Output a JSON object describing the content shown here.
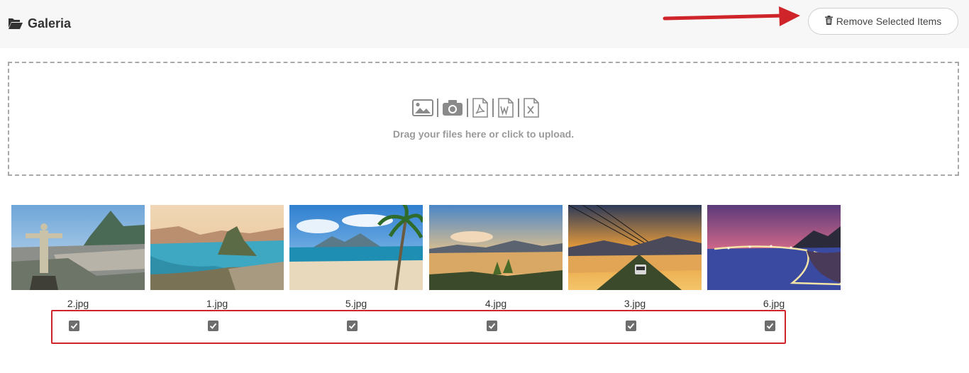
{
  "header": {
    "title": "Galeria",
    "title_icon": "folder-open-icon",
    "remove_button": {
      "label": "Remove Selected Items",
      "icon": "trash-icon"
    }
  },
  "annotation": {
    "arrow_color": "#d0242b",
    "highlight_color": "#d0242b"
  },
  "dropzone": {
    "icons": [
      "image-icon",
      "camera-icon",
      "pdf-file-icon",
      "word-file-icon",
      "excel-file-icon"
    ],
    "text": "Drag your files here or click to upload."
  },
  "gallery": {
    "items": [
      {
        "filename": "2.jpg",
        "checked": true
      },
      {
        "filename": "1.jpg",
        "checked": true
      },
      {
        "filename": "5.jpg",
        "checked": true
      },
      {
        "filename": "4.jpg",
        "checked": true
      },
      {
        "filename": "3.jpg",
        "checked": true
      },
      {
        "filename": "6.jpg",
        "checked": true
      }
    ]
  }
}
